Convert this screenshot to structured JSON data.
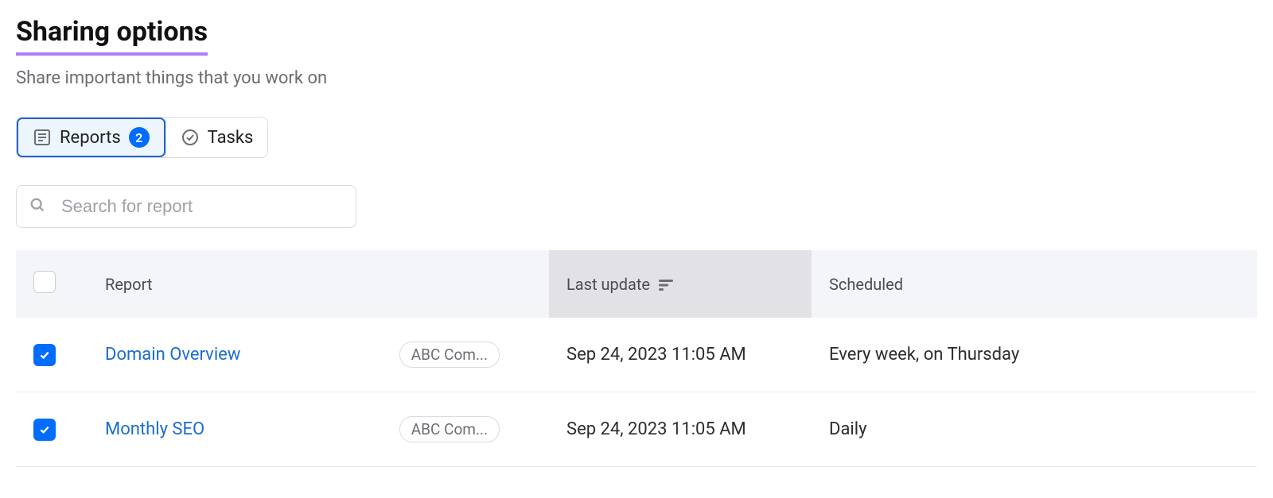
{
  "header": {
    "title": "Sharing options",
    "subtitle": "Share important things that you work on"
  },
  "tabs": {
    "reports": {
      "label": "Reports",
      "badge": "2",
      "active": true
    },
    "tasks": {
      "label": "Tasks",
      "active": false
    }
  },
  "search": {
    "placeholder": "Search for report"
  },
  "table": {
    "columns": {
      "report": "Report",
      "last_update": "Last update",
      "scheduled": "Scheduled"
    },
    "rows": [
      {
        "checked": true,
        "title": "Domain Overview",
        "project": "ABC Com...",
        "last_update": "Sep 24, 2023 11:05 AM",
        "scheduled": "Every week, on Thursday"
      },
      {
        "checked": true,
        "title": "Monthly SEO",
        "project": "ABC Com...",
        "last_update": "Sep 24, 2023 11:05 AM",
        "scheduled": "Daily"
      }
    ]
  }
}
